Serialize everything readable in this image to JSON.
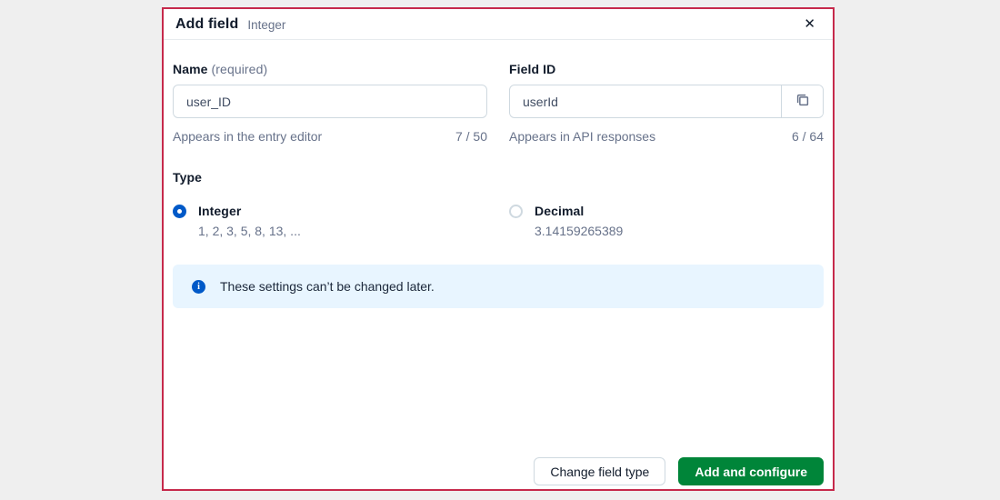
{
  "dialog": {
    "title": "Add field",
    "subtitle": "Integer",
    "close_icon_glyph": "✕"
  },
  "fields": {
    "name": {
      "label": "Name",
      "required_hint": "(required)",
      "value": "user_ID",
      "helper": "Appears in the entry editor",
      "counter": "7 / 50"
    },
    "field_id": {
      "label": "Field ID",
      "value": "userId",
      "helper": "Appears in API responses",
      "counter": "6 / 64"
    }
  },
  "type_section": {
    "label": "Type",
    "options": [
      {
        "label": "Integer",
        "description": "1, 2, 3, 5, 8, 13, ...",
        "selected": true
      },
      {
        "label": "Decimal",
        "description": "3.14159265389",
        "selected": false
      }
    ]
  },
  "notice": {
    "text": "These settings can’t be changed later."
  },
  "footer": {
    "secondary_button": "Change field type",
    "primary_button": "Add and configure"
  },
  "colors": {
    "accent_blue": "#0059C8",
    "primary_green": "#008539",
    "notice_background": "#E8F5FF",
    "input_border": "#CFD9E0",
    "helper_text": "#67728A",
    "highlight_border": "#C6294B"
  }
}
